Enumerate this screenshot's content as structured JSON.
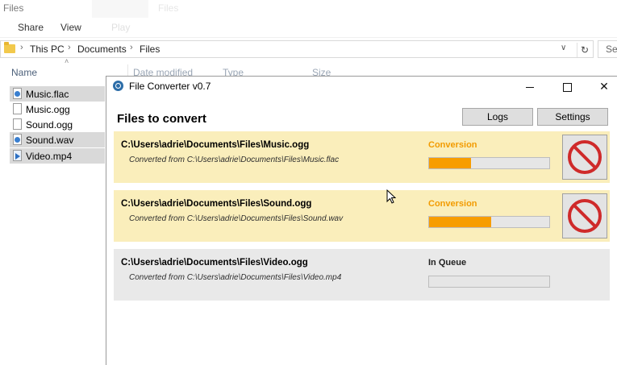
{
  "explorer": {
    "title": "Files",
    "title_faint": "Files",
    "ribbon": {
      "share": "Share",
      "view": "View",
      "faint_tab": "Play"
    },
    "breadcrumb": [
      "This PC",
      "Documents",
      "Files"
    ],
    "search_placeholder": "Se",
    "columns": {
      "name": "Name",
      "date": "Date modified",
      "type": "Type",
      "size": "Size"
    },
    "files": [
      {
        "name": "Music.flac",
        "selected": true,
        "icon": "audio-file-icon"
      },
      {
        "name": "Music.ogg",
        "selected": false,
        "icon": "file-icon"
      },
      {
        "name": "Sound.ogg",
        "selected": false,
        "icon": "file-icon"
      },
      {
        "name": "Sound.wav",
        "selected": true,
        "icon": "audio-file-icon"
      },
      {
        "name": "Video.mp4",
        "selected": true,
        "icon": "video-file-icon"
      }
    ]
  },
  "converter": {
    "title": "File Converter v0.7",
    "heading": "Files to convert",
    "logs_label": "Logs",
    "settings_label": "Settings",
    "jobs": [
      {
        "output": "C:\\Users\\adrie\\Documents\\Files\\Music.ogg",
        "source": "Converted from C:\\Users\\adrie\\Documents\\Files\\Music.flac",
        "status": "Conversion",
        "progress": 0.35,
        "cancellable": true
      },
      {
        "output": "C:\\Users\\adrie\\Documents\\Files\\Sound.ogg",
        "source": "Converted from C:\\Users\\adrie\\Documents\\Files\\Sound.wav",
        "status": "Conversion",
        "progress": 0.52,
        "cancellable": true
      },
      {
        "output": "C:\\Users\\adrie\\Documents\\Files\\Video.ogg",
        "source": "Converted from C:\\Users\\adrie\\Documents\\Files\\Video.mp4",
        "status": "In Queue",
        "progress": 0,
        "cancellable": false
      }
    ]
  },
  "colors": {
    "active_row": "#faeebb",
    "queued_row": "#e9e9e9",
    "progress_fill": "#f79d00",
    "status_conversion": "#f29b00"
  }
}
